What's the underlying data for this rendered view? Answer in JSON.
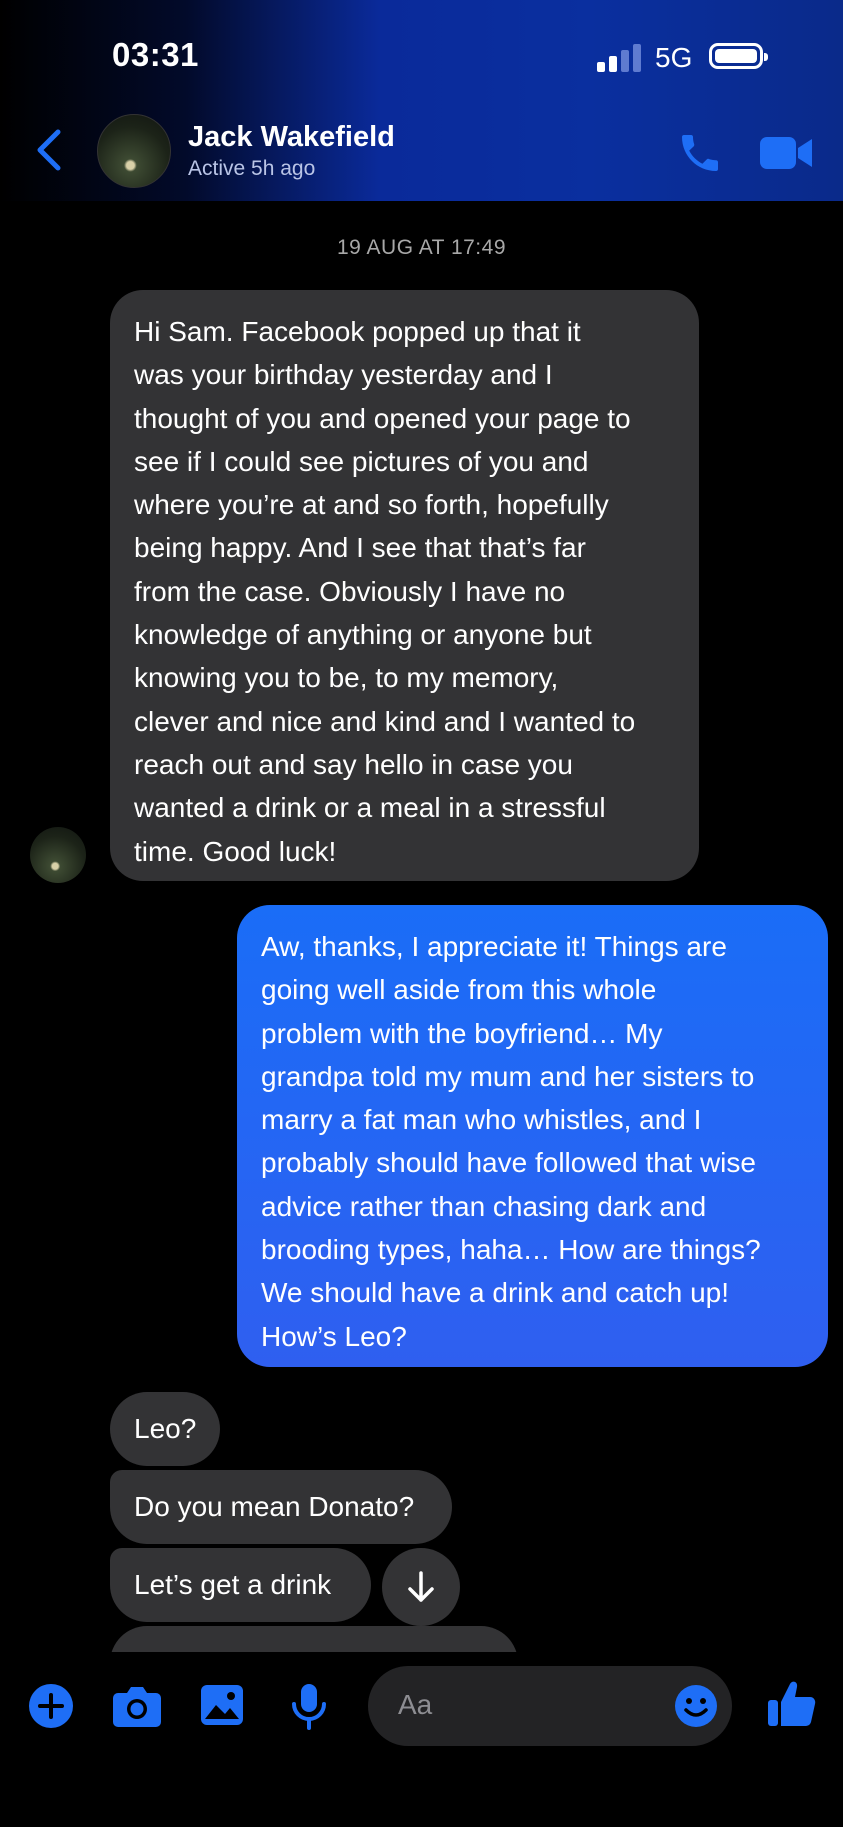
{
  "status_bar": {
    "time": "03:31",
    "network": "5G"
  },
  "header": {
    "contact_name": "Jack Wakefield",
    "status": "Active 5h ago"
  },
  "thread": {
    "timestamp": "19 AUG AT 17:49",
    "messages": [
      {
        "sender": "Jack Wakefield",
        "text": "Hi Sam.  Facebook popped up that it\nwas your birthday yesterday and I\nthought of you and opened your page to\nsee if I could see pictures of you and\nwhere you’re at and so forth, hopefully\nbeing happy.  And I see that that’s far\nfrom the case.  Obviously I have no\nknowledge of anything or anyone but\nknowing you to be, to my memory,\nclever and nice and kind and I wanted to\nreach out and say hello in case you\nwanted a drink or a meal in a stressful\ntime.  Good luck!"
      },
      {
        "sender": "me",
        "text": "Aw, thanks, I appreciate it! Things are\ngoing well aside from this whole\nproblem with the boyfriend… My\ngrandpa told my mum and her sisters to\nmarry a fat man who whistles, and I\nprobably should have followed that wise\nadvice rather than chasing dark and\nbrooding types, haha… How are things?\nWe should have a drink and catch up!\nHow’s Leo?"
      },
      {
        "sender": "Jack Wakefield",
        "text": "Leo?"
      },
      {
        "sender": "Jack Wakefield",
        "text": "Do you mean Donato?"
      },
      {
        "sender": "Jack Wakefield",
        "text": "Let’s get a drink"
      }
    ]
  },
  "composer": {
    "placeholder": "Aa"
  },
  "colors": {
    "accent": "#1e6ef6",
    "incoming_bubble": "#333335",
    "outgoing_bubble": "#1a6df7"
  }
}
